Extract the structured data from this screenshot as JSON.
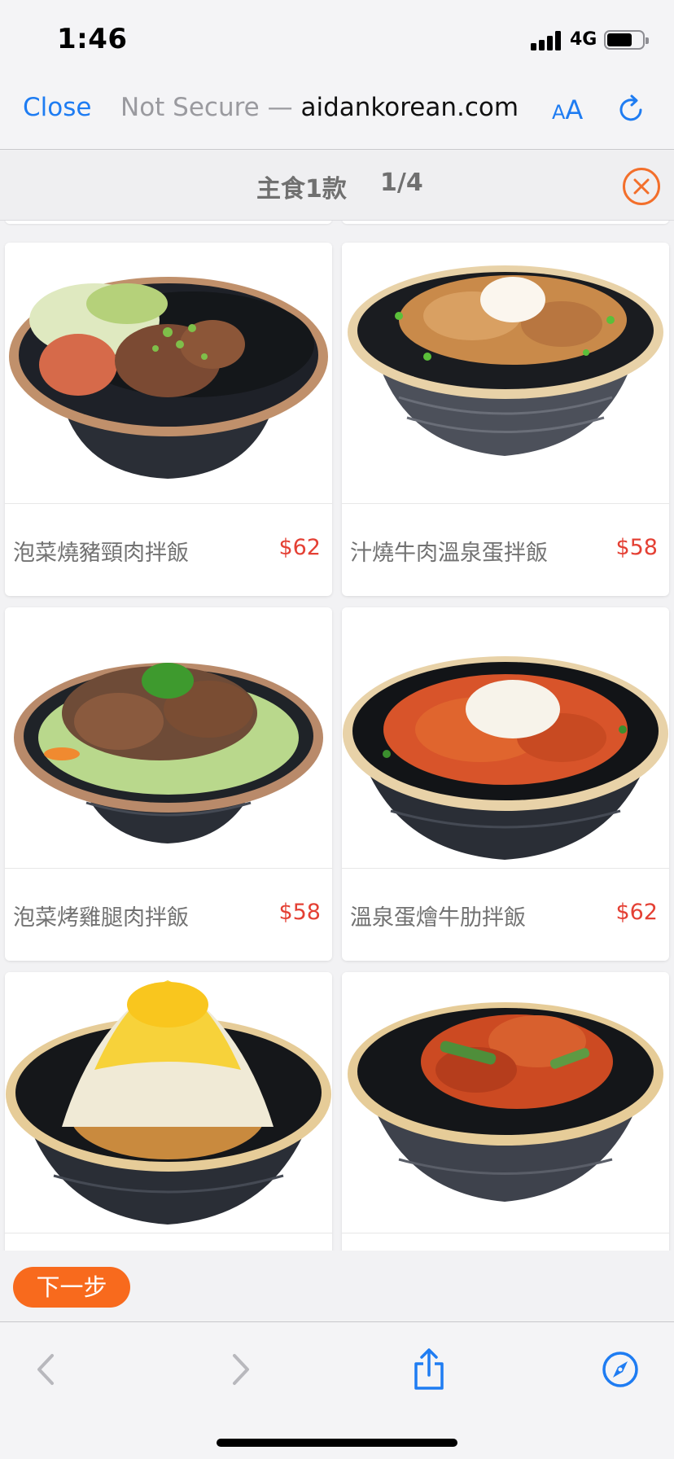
{
  "status_bar": {
    "time": "1:46",
    "network": "4G",
    "battery_level": 0.72
  },
  "browser": {
    "close_label": "Close",
    "url_insecure": "Not Secure — ",
    "url_domain": "aidankorean.com",
    "aa_small": "A",
    "aa_big": "A"
  },
  "modal": {
    "title": "主食1款",
    "page": "1/4"
  },
  "items": [
    {
      "name": "泡菜燒豬頸肉拌飯",
      "price": "$62"
    },
    {
      "name": "汁燒牛肉溫泉蛋拌飯",
      "price": "$58"
    },
    {
      "name": "泡菜烤雞腿肉拌飯",
      "price": "$58"
    },
    {
      "name": "溫泉蛋燴牛肋拌飯",
      "price": "$62"
    },
    {
      "name": "",
      "price": ""
    },
    {
      "name": "",
      "price": ""
    }
  ],
  "footer": {
    "next_label": "下一步"
  },
  "colors": {
    "accent_orange": "#f86a1d",
    "price_red": "#e44034",
    "ios_blue": "#1e7cf2"
  }
}
